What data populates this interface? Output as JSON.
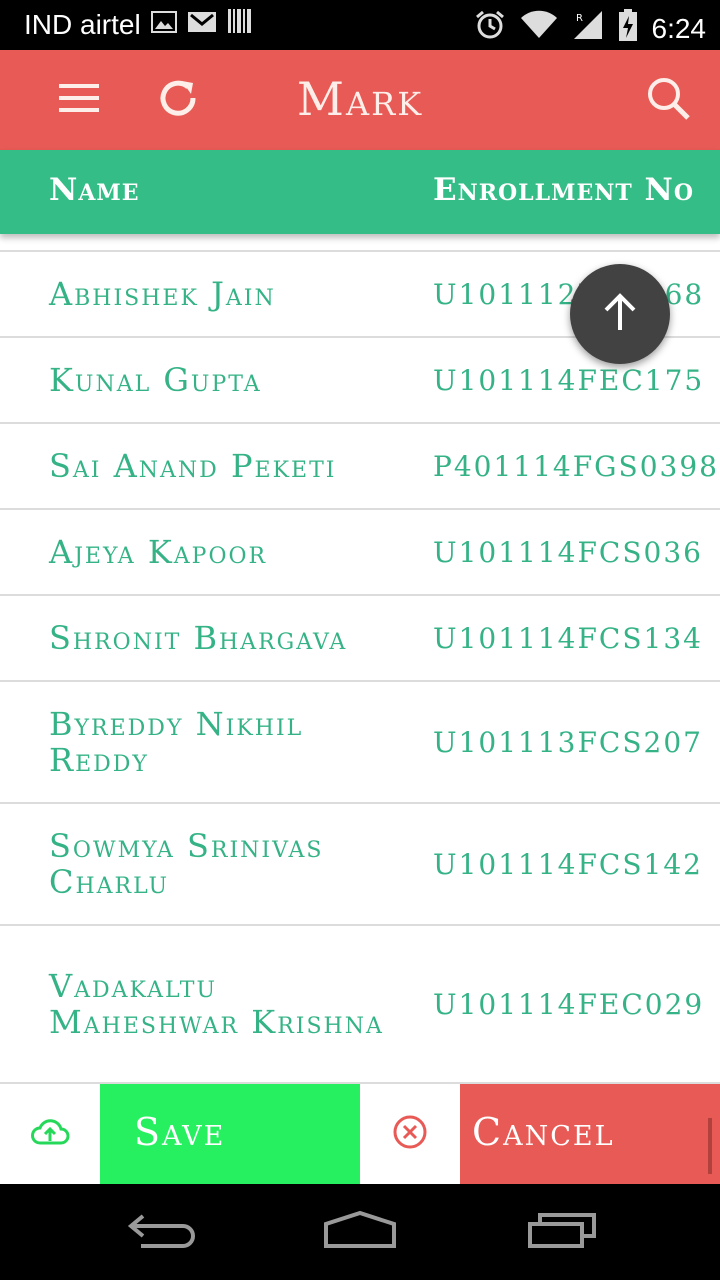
{
  "status_bar": {
    "carrier": "IND airtel",
    "time": "6:24",
    "icons_left": [
      "image-icon",
      "gmail-icon",
      "barcode-icon"
    ],
    "icons_right": [
      "alarm-icon",
      "wifi-icon",
      "signal-icon",
      "battery-icon"
    ]
  },
  "app_bar": {
    "title": "Mark",
    "menu_icon": "menu-icon",
    "refresh_icon": "refresh-icon",
    "search_icon": "search-icon",
    "color": "#e85a55"
  },
  "table": {
    "header": {
      "name": "Name",
      "enrollment": "Enrollment No"
    },
    "header_color": "#35bd87",
    "text_color": "#35b386",
    "rows": [
      {
        "name": "Abhishek Jain",
        "enrollment": "U101112FEC068"
      },
      {
        "name": "Kunal Gupta",
        "enrollment": "U101114FEC175"
      },
      {
        "name": "Sai Anand Peketi",
        "enrollment": "P401114FGS0398"
      },
      {
        "name": "Ajeya Kapoor",
        "enrollment": "U101114FCS036"
      },
      {
        "name": "Shronit Bhargava",
        "enrollment": "U101114FCS134"
      },
      {
        "name": "Byreddy Nikhil Reddy",
        "enrollment": "U101113FCS207"
      },
      {
        "name": "Sowmya Srinivas Charlu",
        "enrollment": "U101114FCS142"
      },
      {
        "name": "Vadakaltu Maheshwar Krishna",
        "enrollment": "U101114FEC029"
      }
    ]
  },
  "fab": {
    "icon": "arrow-up-icon"
  },
  "actions": {
    "save_label": "Save",
    "save_icon": "cloud-upload-icon",
    "save_color": "#26f060",
    "cancel_label": "Cancel",
    "cancel_icon": "cancel-circle-icon",
    "cancel_color": "#e85a55"
  },
  "nav_bar": {
    "icons": [
      "back-icon",
      "home-icon",
      "recents-icon"
    ]
  }
}
